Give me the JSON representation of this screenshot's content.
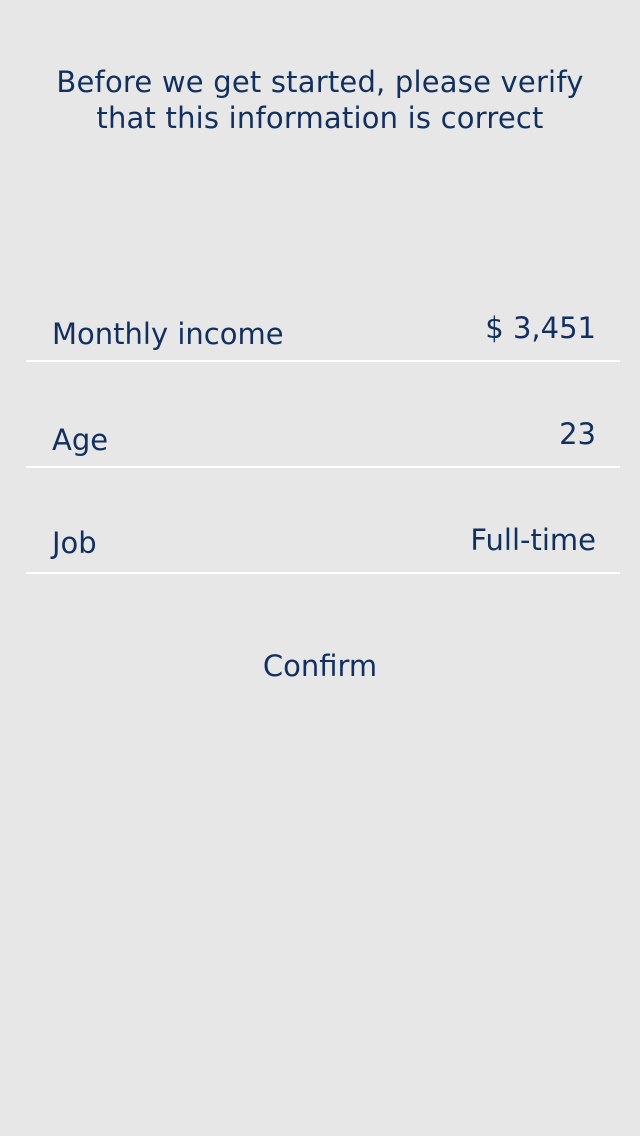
{
  "header": {
    "line1": "Before we get started, please verify",
    "line2": "that this information is correct"
  },
  "fields": [
    {
      "label": "Monthly income",
      "value": "$ 3,451"
    },
    {
      "label": "Age",
      "value": "23"
    },
    {
      "label": "Job",
      "value": "Full-time"
    }
  ],
  "actions": {
    "confirm_label": "Confirm"
  },
  "colors": {
    "background": "#e7e7e7",
    "text": "#12305f",
    "divider": "#ffffff"
  }
}
